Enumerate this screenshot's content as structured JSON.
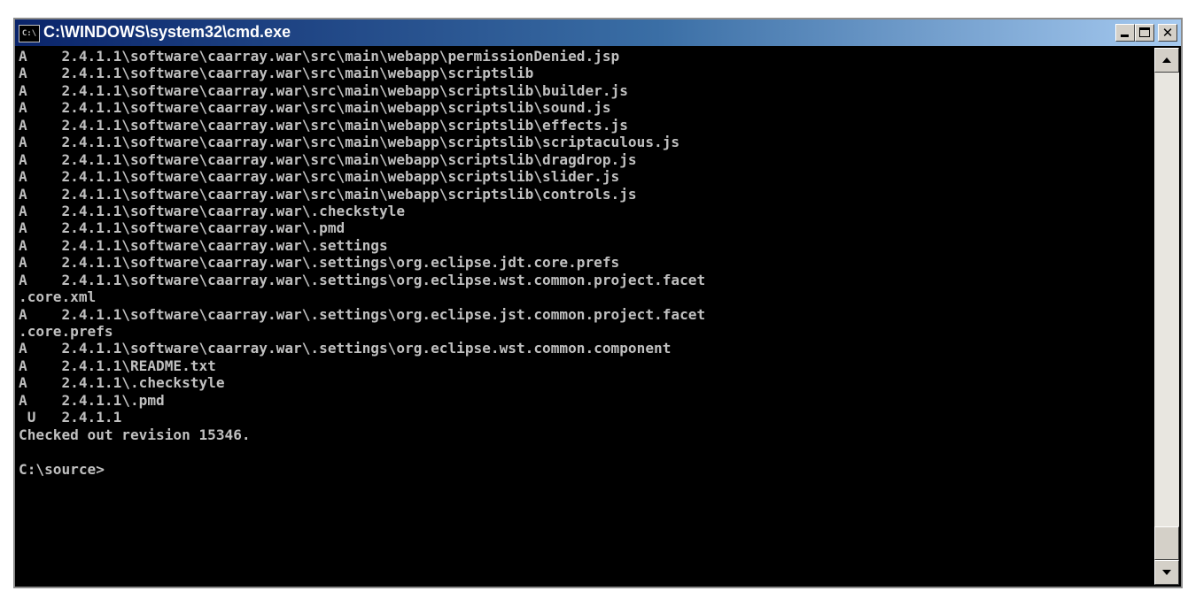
{
  "window": {
    "title": "C:\\WINDOWS\\system32\\cmd.exe",
    "icon_label": "C:\\",
    "icon": "cmd-icon",
    "buttons": [
      "minimize-icon",
      "maximize-icon",
      "close-icon"
    ]
  },
  "console": {
    "lines": [
      "A    2.4.1.1\\software\\caarray.war\\src\\main\\webapp\\permissionDenied.jsp",
      "A    2.4.1.1\\software\\caarray.war\\src\\main\\webapp\\scriptslib",
      "A    2.4.1.1\\software\\caarray.war\\src\\main\\webapp\\scriptslib\\builder.js",
      "A    2.4.1.1\\software\\caarray.war\\src\\main\\webapp\\scriptslib\\sound.js",
      "A    2.4.1.1\\software\\caarray.war\\src\\main\\webapp\\scriptslib\\effects.js",
      "A    2.4.1.1\\software\\caarray.war\\src\\main\\webapp\\scriptslib\\scriptaculous.js",
      "A    2.4.1.1\\software\\caarray.war\\src\\main\\webapp\\scriptslib\\dragdrop.js",
      "A    2.4.1.1\\software\\caarray.war\\src\\main\\webapp\\scriptslib\\slider.js",
      "A    2.4.1.1\\software\\caarray.war\\src\\main\\webapp\\scriptslib\\controls.js",
      "A    2.4.1.1\\software\\caarray.war\\.checkstyle",
      "A    2.4.1.1\\software\\caarray.war\\.pmd",
      "A    2.4.1.1\\software\\caarray.war\\.settings",
      "A    2.4.1.1\\software\\caarray.war\\.settings\\org.eclipse.jdt.core.prefs",
      "A    2.4.1.1\\software\\caarray.war\\.settings\\org.eclipse.wst.common.project.facet",
      ".core.xml",
      "A    2.4.1.1\\software\\caarray.war\\.settings\\org.eclipse.jst.common.project.facet",
      ".core.prefs",
      "A    2.4.1.1\\software\\caarray.war\\.settings\\org.eclipse.wst.common.component",
      "A    2.4.1.1\\README.txt",
      "A    2.4.1.1\\.checkstyle",
      "A    2.4.1.1\\.pmd",
      " U   2.4.1.1",
      "Checked out revision 15346.",
      "",
      "C:\\source>"
    ]
  },
  "scrollbar": {
    "up_icon": "scroll-up-arrow-icon",
    "down_icon": "scroll-down-arrow-icon",
    "position": 0.96
  }
}
